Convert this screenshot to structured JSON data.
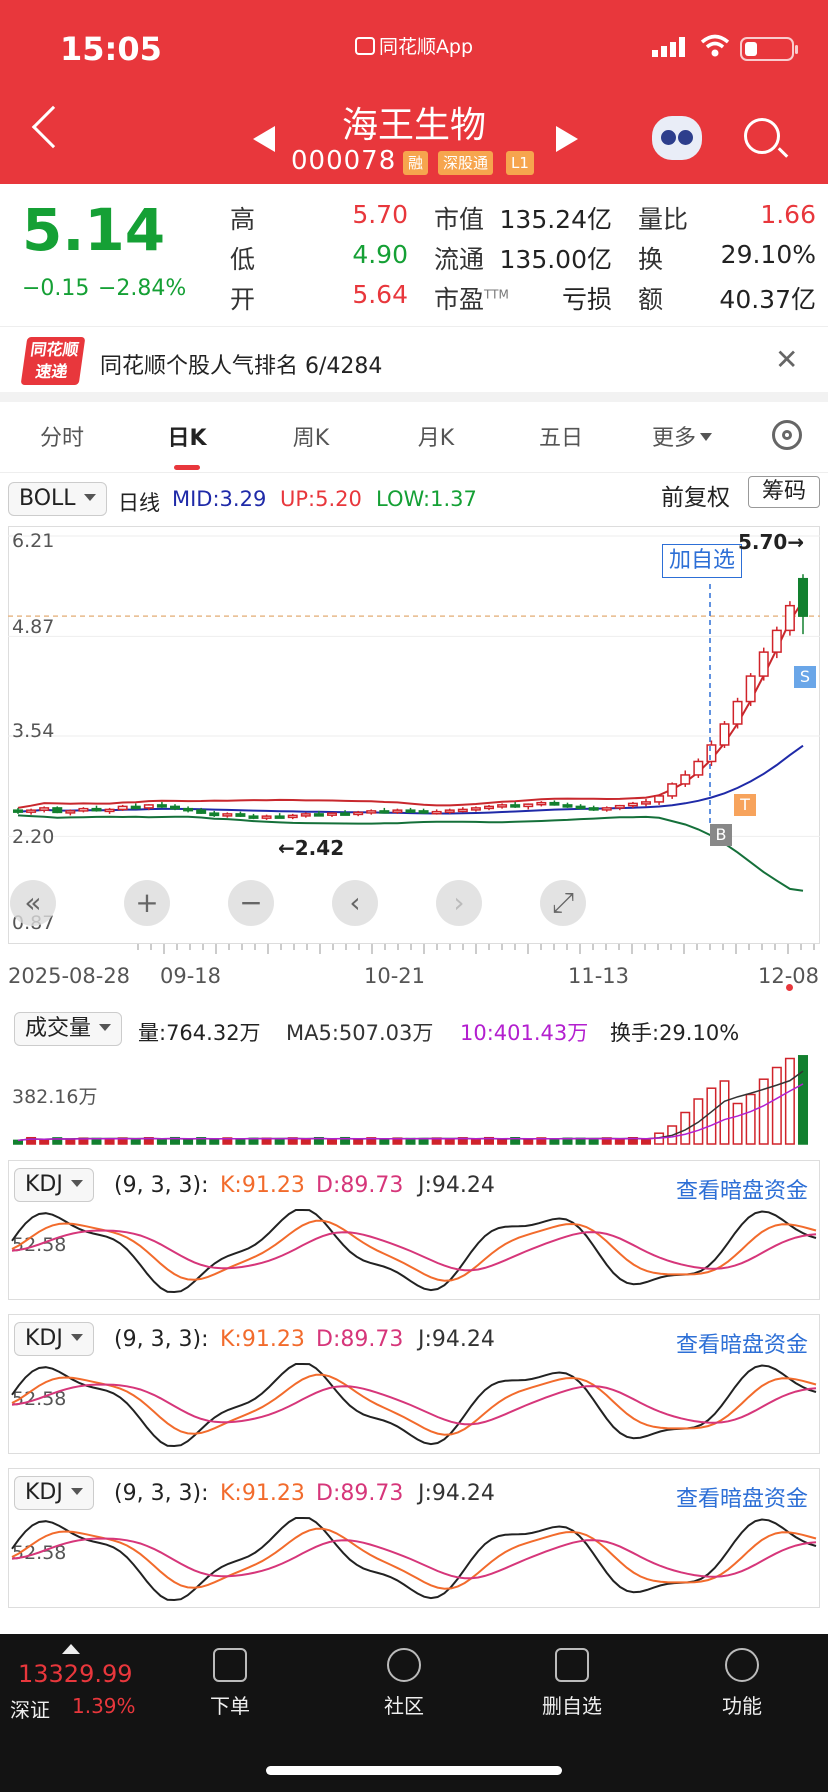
{
  "status_bar": {
    "time": "15:05",
    "app": "同花顺App"
  },
  "header": {
    "stock_name": "海王生物",
    "stock_code": "000078",
    "tags": [
      "融",
      "深股通",
      "L1"
    ]
  },
  "quote": {
    "price": "5.14",
    "change": "−0.15",
    "change_pct": "−2.84%",
    "high_label": "高",
    "high": "5.70",
    "low_label": "低",
    "low": "4.90",
    "open_label": "开",
    "open": "5.64",
    "mcap_label": "市值",
    "mcap": "135.24亿",
    "float_label": "流通",
    "float": "135.00亿",
    "pe_label": "市盈",
    "pe_sup": "TTM",
    "pe": "亏损",
    "vr_label": "量比",
    "vr": "1.66",
    "turn_label": "换",
    "turn": "29.10%",
    "amt_label": "额",
    "amt": "40.37亿"
  },
  "banner": {
    "logo_top": "同花顺",
    "logo_bottom": "速递",
    "text": "同花顺个股人气排名 6/4284"
  },
  "tabs": [
    "分时",
    "日K",
    "周K",
    "月K",
    "五日",
    "更多"
  ],
  "kline": {
    "indicator": "BOLL",
    "period": "日线",
    "mid": "MID:3.29",
    "up": "UP:5.20",
    "low": "LOW:1.37",
    "adjust": "前复权",
    "chip": "筹码",
    "add_watch": "加自选",
    "high_mark": "5.70→",
    "low_mark": "←2.42",
    "markers": {
      "b": "B",
      "s": "S",
      "t": "T"
    },
    "dates": [
      "2025-08-28",
      "09-18",
      "10-21",
      "11-13",
      "12-08"
    ],
    "controls": [
      "«",
      "+",
      "−",
      "‹",
      "›",
      "⤢"
    ]
  },
  "volume": {
    "indicator": "成交量",
    "vol": "量:764.32万",
    "ma5": "MA5:507.03万",
    "ma10": "10:401.43万",
    "turnover": "换手:29.10%"
  },
  "kdj_panels": [
    {
      "indicator": "KDJ",
      "params": "(9, 3, 3):",
      "k": "K:91.23",
      "d": "D:89.73",
      "j": "J:94.24",
      "link": "查看暗盘资金"
    },
    {
      "indicator": "KDJ",
      "params": "(9, 3, 3):",
      "k": "K:91.23",
      "d": "D:89.73",
      "j": "J:94.24",
      "link": "查看暗盘资金"
    },
    {
      "indicator": "KDJ",
      "params": "(9, 3, 3):",
      "k": "K:91.23",
      "d": "D:89.73",
      "j": "J:94.24",
      "link": "查看暗盘资金"
    }
  ],
  "bottom_nav": {
    "index_value": "13329.99",
    "index_name": "深证",
    "index_pct": "1.39%",
    "items": [
      "下单",
      "社区",
      "删自选",
      "功能"
    ]
  },
  "chart_data": {
    "type": "candlestick",
    "title": "海王生物 000078 日K",
    "price_axis_ticks": [
      "6.21",
      "4.87",
      "3.54",
      "2.20",
      "0.87"
    ],
    "volume_axis_tick": "382.16万",
    "kdj_axis_tick": "52.58",
    "x_labels": [
      "2025-08-28",
      "09-18",
      "10-21",
      "11-13",
      "12-08"
    ],
    "candles": [
      [
        2.55,
        2.58,
        2.5,
        2.53
      ],
      [
        2.53,
        2.57,
        2.49,
        2.55
      ],
      [
        2.55,
        2.6,
        2.52,
        2.58
      ],
      [
        2.58,
        2.6,
        2.51,
        2.52
      ],
      [
        2.52,
        2.56,
        2.48,
        2.54
      ],
      [
        2.54,
        2.59,
        2.52,
        2.57
      ],
      [
        2.57,
        2.61,
        2.53,
        2.55
      ],
      [
        2.55,
        2.58,
        2.5,
        2.56
      ],
      [
        2.56,
        2.62,
        2.54,
        2.6
      ],
      [
        2.6,
        2.64,
        2.56,
        2.58
      ],
      [
        2.58,
        2.63,
        2.55,
        2.62
      ],
      [
        2.62,
        2.66,
        2.58,
        2.6
      ],
      [
        2.6,
        2.63,
        2.55,
        2.57
      ],
      [
        2.57,
        2.6,
        2.52,
        2.55
      ],
      [
        2.55,
        2.58,
        2.5,
        2.51
      ],
      [
        2.51,
        2.54,
        2.46,
        2.48
      ],
      [
        2.48,
        2.52,
        2.45,
        2.5
      ],
      [
        2.5,
        2.53,
        2.46,
        2.47
      ],
      [
        2.47,
        2.5,
        2.43,
        2.45
      ],
      [
        2.45,
        2.49,
        2.42,
        2.47
      ],
      [
        2.47,
        2.51,
        2.44,
        2.46
      ],
      [
        2.46,
        2.5,
        2.43,
        2.48
      ],
      [
        2.48,
        2.52,
        2.45,
        2.5
      ],
      [
        2.5,
        2.54,
        2.47,
        2.49
      ],
      [
        2.49,
        2.52,
        2.46,
        2.51
      ],
      [
        2.51,
        2.55,
        2.48,
        2.5
      ],
      [
        2.5,
        2.54,
        2.47,
        2.52
      ],
      [
        2.52,
        2.56,
        2.49,
        2.54
      ],
      [
        2.54,
        2.58,
        2.51,
        2.53
      ],
      [
        2.53,
        2.57,
        2.5,
        2.55
      ],
      [
        2.55,
        2.58,
        2.52,
        2.54
      ],
      [
        2.54,
        2.57,
        2.5,
        2.52
      ],
      [
        2.52,
        2.56,
        2.49,
        2.53
      ],
      [
        2.53,
        2.57,
        2.5,
        2.55
      ],
      [
        2.55,
        2.59,
        2.52,
        2.56
      ],
      [
        2.56,
        2.6,
        2.53,
        2.58
      ],
      [
        2.58,
        2.62,
        2.55,
        2.6
      ],
      [
        2.6,
        2.64,
        2.57,
        2.62
      ],
      [
        2.62,
        2.66,
        2.58,
        2.6
      ],
      [
        2.6,
        2.64,
        2.56,
        2.63
      ],
      [
        2.63,
        2.67,
        2.6,
        2.65
      ],
      [
        2.65,
        2.68,
        2.61,
        2.62
      ],
      [
        2.62,
        2.65,
        2.58,
        2.6
      ],
      [
        2.6,
        2.63,
        2.56,
        2.58
      ],
      [
        2.58,
        2.61,
        2.54,
        2.56
      ],
      [
        2.56,
        2.6,
        2.53,
        2.58
      ],
      [
        2.58,
        2.62,
        2.55,
        2.61
      ],
      [
        2.61,
        2.66,
        2.58,
        2.64
      ],
      [
        2.64,
        2.7,
        2.6,
        2.66
      ],
      [
        2.66,
        2.76,
        2.62,
        2.74
      ],
      [
        2.74,
        2.92,
        2.7,
        2.9
      ],
      [
        2.9,
        3.08,
        2.86,
        3.02
      ],
      [
        3.02,
        3.24,
        2.98,
        3.2
      ],
      [
        3.2,
        3.48,
        3.14,
        3.42
      ],
      [
        3.42,
        3.74,
        3.38,
        3.7
      ],
      [
        3.7,
        4.05,
        3.64,
        4.0
      ],
      [
        4.0,
        4.38,
        3.94,
        4.34
      ],
      [
        4.34,
        4.72,
        4.28,
        4.66
      ],
      [
        4.66,
        5.0,
        4.58,
        4.95
      ],
      [
        4.95,
        5.34,
        4.88,
        5.28
      ],
      [
        5.64,
        5.7,
        4.9,
        5.14
      ]
    ],
    "volume_ratio": "low baseline then sharp spike in final 12 sessions"
  }
}
